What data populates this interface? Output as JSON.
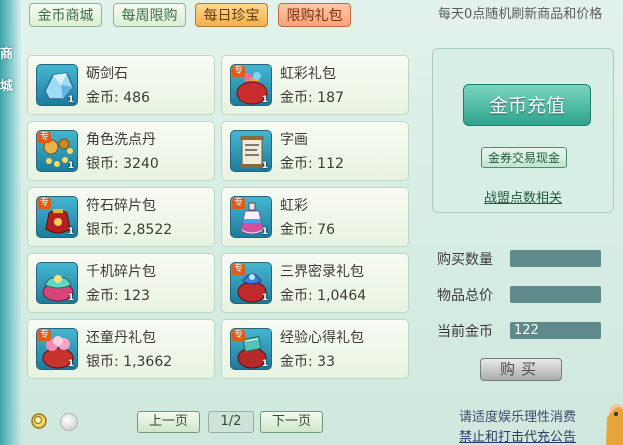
{
  "side_chars": [
    "商",
    "城"
  ],
  "tabs": [
    {
      "label": "金币商城",
      "state": "normal"
    },
    {
      "label": "每周限购",
      "state": "normal"
    },
    {
      "label": "每日珍宝",
      "state": "active"
    },
    {
      "label": "限购礼包",
      "state": "gift"
    }
  ],
  "notice": "每天0点随机刷新商品和价格",
  "items": [
    {
      "name": "砺剑石",
      "price": "金币: 486",
      "qty": "1",
      "icon": "crystal-ore-icon",
      "exclusive": ""
    },
    {
      "name": "虹彩礼包",
      "price": "金币: 187",
      "qty": "1",
      "icon": "red-gift-bag-icon",
      "exclusive": "专"
    },
    {
      "name": "角色洗点丹",
      "price": "银币: 3240",
      "qty": "1",
      "icon": "golden-pills-icon",
      "exclusive": "专"
    },
    {
      "name": "字画",
      "price": "金币: 112",
      "qty": "1",
      "icon": "scroll-painting-icon",
      "exclusive": ""
    },
    {
      "name": "符石碎片包",
      "price": "银币: 2,8522",
      "qty": "1",
      "icon": "red-pouch-icon",
      "exclusive": "专"
    },
    {
      "name": "虹彩",
      "price": "金币: 76",
      "qty": "1",
      "icon": "rainbow-bottle-icon",
      "exclusive": "专"
    },
    {
      "name": "千机碎片包",
      "price": "金币: 123",
      "qty": "1",
      "icon": "lotus-bag-icon",
      "exclusive": ""
    },
    {
      "name": "三界密录礼包",
      "price": "金币: 1,0464",
      "qty": "1",
      "icon": "blue-gift-bag-icon",
      "exclusive": "专"
    },
    {
      "name": "还童丹礼包",
      "price": "银币: 1,3662",
      "qty": "1",
      "icon": "pink-gift-bag-icon",
      "exclusive": "专"
    },
    {
      "name": "经验心得礼包",
      "price": "金币: 33",
      "qty": "1",
      "icon": "book-gift-bag-icon",
      "exclusive": "专"
    }
  ],
  "right_panel": {
    "recharge_label": "金币充值",
    "coupon_label": "金券交易现金",
    "alliance_label": "战盟点数相关"
  },
  "form": {
    "quantity_label": "购买数量",
    "quantity_value": "",
    "total_label": "物品总价",
    "total_value": "",
    "current_label": "当前金币",
    "current_value": "122"
  },
  "buy_label": "购买",
  "pagination": {
    "prev_label": "上一页",
    "indicator": "1/2",
    "next_label": "下一页"
  },
  "footer": {
    "line1": "请适度娱乐理性消费",
    "line2": "禁止和打击代充公告"
  },
  "colors": {
    "background": "#d6ede4",
    "accent_active_tab": "#f2b04b",
    "recharge_button": "#2fa38d",
    "field_bg": "#5f8a8c"
  }
}
